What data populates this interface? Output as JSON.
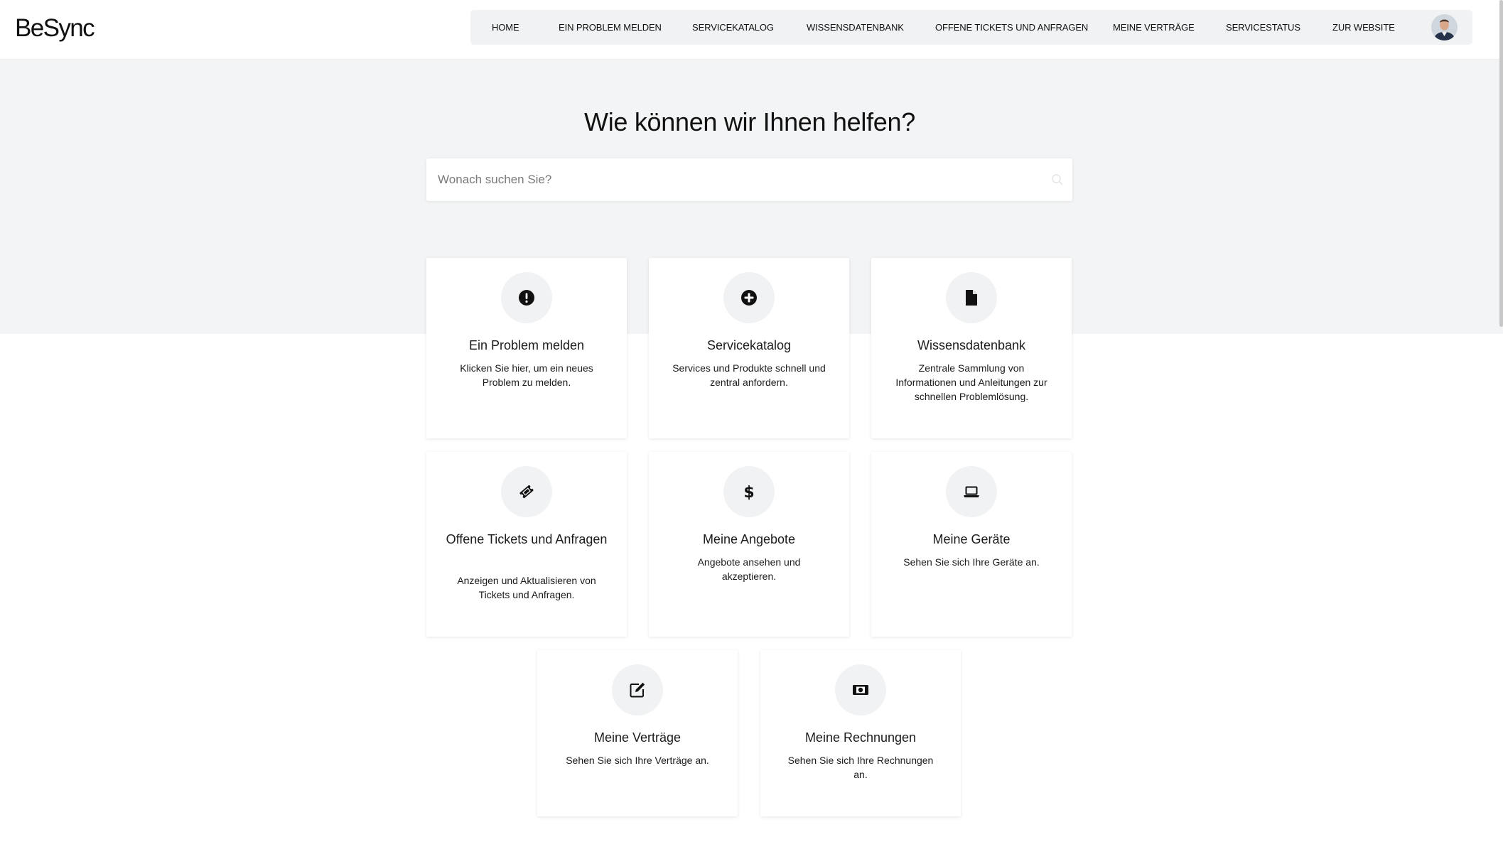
{
  "brand": {
    "logo": "BeSync"
  },
  "nav": {
    "items": [
      {
        "label": "HOME"
      },
      {
        "label": "EIN PROBLEM MELDEN"
      },
      {
        "label": "SERVICEKATALOG"
      },
      {
        "label": "WISSENSDATENBANK"
      },
      {
        "label": "OFFENE TICKETS UND ANFRAGEN"
      },
      {
        "label": "MEINE VERTRÄGE"
      },
      {
        "label": "SERVICESTATUS"
      },
      {
        "label": "ZUR WEBSITE"
      }
    ]
  },
  "hero": {
    "title": "Wie können wir Ihnen helfen?",
    "search_placeholder": "Wonach suchen Sie?"
  },
  "cards": [
    {
      "title": "Ein Problem melden",
      "description": "Klicken Sie hier, um ein neues Problem zu melden.",
      "icon": "exclamation-circle-icon"
    },
    {
      "title": "Servicekatalog",
      "description": "Services und Produkte schnell und zentral anfordern.",
      "icon": "plus-circle-icon"
    },
    {
      "title": "Wissensdatenbank",
      "description": "Zentrale Sammlung von Informationen und Anleitungen zur schnellen Problemlösung.",
      "icon": "document-icon"
    },
    {
      "title": "Offene Tickets und Anfragen",
      "description": "Anzeigen und Aktualisieren von Tickets und Anfragen.",
      "icon": "ticket-icon"
    },
    {
      "title": "Meine Angebote",
      "description": "Angebote ansehen und akzeptieren.",
      "icon": "dollar-icon"
    },
    {
      "title": "Meine Geräte",
      "description": "Sehen Sie sich Ihre Geräte an.",
      "icon": "laptop-icon"
    },
    {
      "title": "Meine Verträge",
      "description": "Sehen Sie sich Ihre Verträge an.",
      "icon": "edit-icon"
    },
    {
      "title": "Meine Rechnungen",
      "description": "Sehen Sie sich Ihre Rechnungen an.",
      "icon": "money-bill-icon"
    }
  ],
  "colors": {
    "hero_background": "#f3f4f5",
    "nav_background": "#f1f2f3",
    "icon_circle": "#f1f2f3",
    "text": "#1b1b1b"
  }
}
